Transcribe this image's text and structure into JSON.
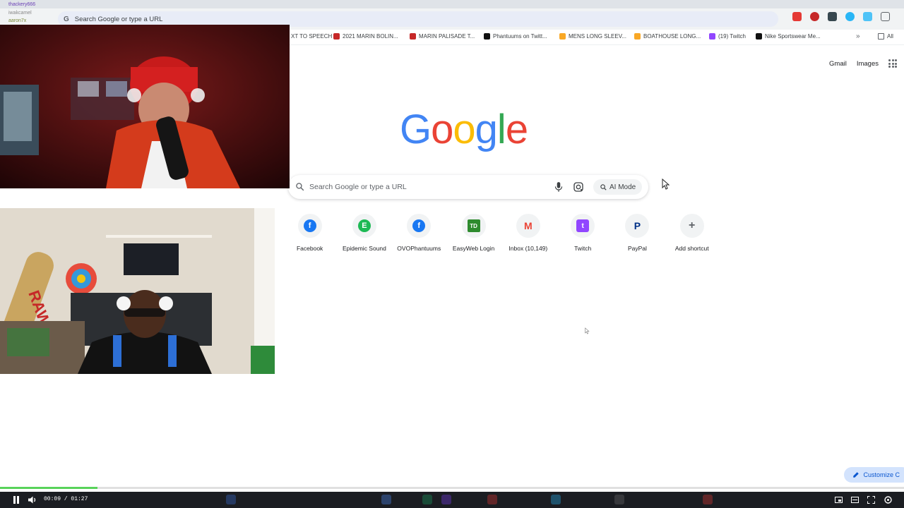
{
  "browser": {
    "omnibox_placeholder": "Search Google or type a URL",
    "bookmarks": [
      {
        "label": "XT TO SPEECH",
        "color": "#ffffff"
      },
      {
        "label": "2021 MARIN BOLIN...",
        "color": "#c62828"
      },
      {
        "label": "MARIN PALISADE T...",
        "color": "#c62828"
      },
      {
        "label": "Phantuums on Twitt...",
        "color": "#111111"
      },
      {
        "label": "MENS LONG SLEEV...",
        "color": "#f9a825"
      },
      {
        "label": "BOATHOUSE LONG...",
        "color": "#f9a825"
      },
      {
        "label": "(19) Twitch",
        "color": "#9146ff"
      },
      {
        "label": "Nike Sportswear Me...",
        "color": "#111111"
      }
    ],
    "bookmarks_overflow": "»",
    "all_bookmarks": "All"
  },
  "header": {
    "gmail": "Gmail",
    "images": "Images"
  },
  "logo": {
    "letters": [
      "G",
      "o",
      "o",
      "g",
      "l",
      "e"
    ],
    "colors": [
      "#4285f4",
      "#ea4335",
      "#fbbc05",
      "#4285f4",
      "#34a853",
      "#ea4335"
    ]
  },
  "search": {
    "placeholder": "Search Google or type a URL",
    "ai_mode_label": "AI Mode"
  },
  "shortcuts": [
    {
      "label": "Facebook",
      "icon": "facebook-icon",
      "color": "#1877f2",
      "glyph": "f"
    },
    {
      "label": "Epidemic Sound",
      "icon": "epidemic-sound-icon",
      "color": "#1db954",
      "glyph": "E"
    },
    {
      "label": "OVOPhantuums",
      "icon": "facebook-icon",
      "color": "#1877f2",
      "glyph": "f"
    },
    {
      "label": "EasyWeb Login",
      "icon": "td-bank-icon",
      "color": "#2e8b2e",
      "glyph": "TD"
    },
    {
      "label": "Inbox (10,149)",
      "icon": "gmail-icon",
      "color": "#ea4335",
      "glyph": "M"
    },
    {
      "label": "Twitch",
      "icon": "twitch-icon",
      "color": "#9146ff",
      "glyph": "t"
    },
    {
      "label": "PayPal",
      "icon": "paypal-icon",
      "color": "#003087",
      "glyph": "P"
    },
    {
      "label": "Add shortcut",
      "icon": "plus-icon",
      "color": "#5f6368",
      "glyph": "+"
    }
  ],
  "customize": {
    "label": "Customize C"
  },
  "chat": {
    "line1": "thackery666",
    "line2": "iwakcamel",
    "line3": "aaron7x"
  },
  "player": {
    "time": "00:09 / 01:27",
    "progress": 0.108
  },
  "colors": {
    "accent_green": "#58d35a",
    "chrome_bg": "#f1f3f4",
    "customize_bg": "#d3e3fd"
  }
}
